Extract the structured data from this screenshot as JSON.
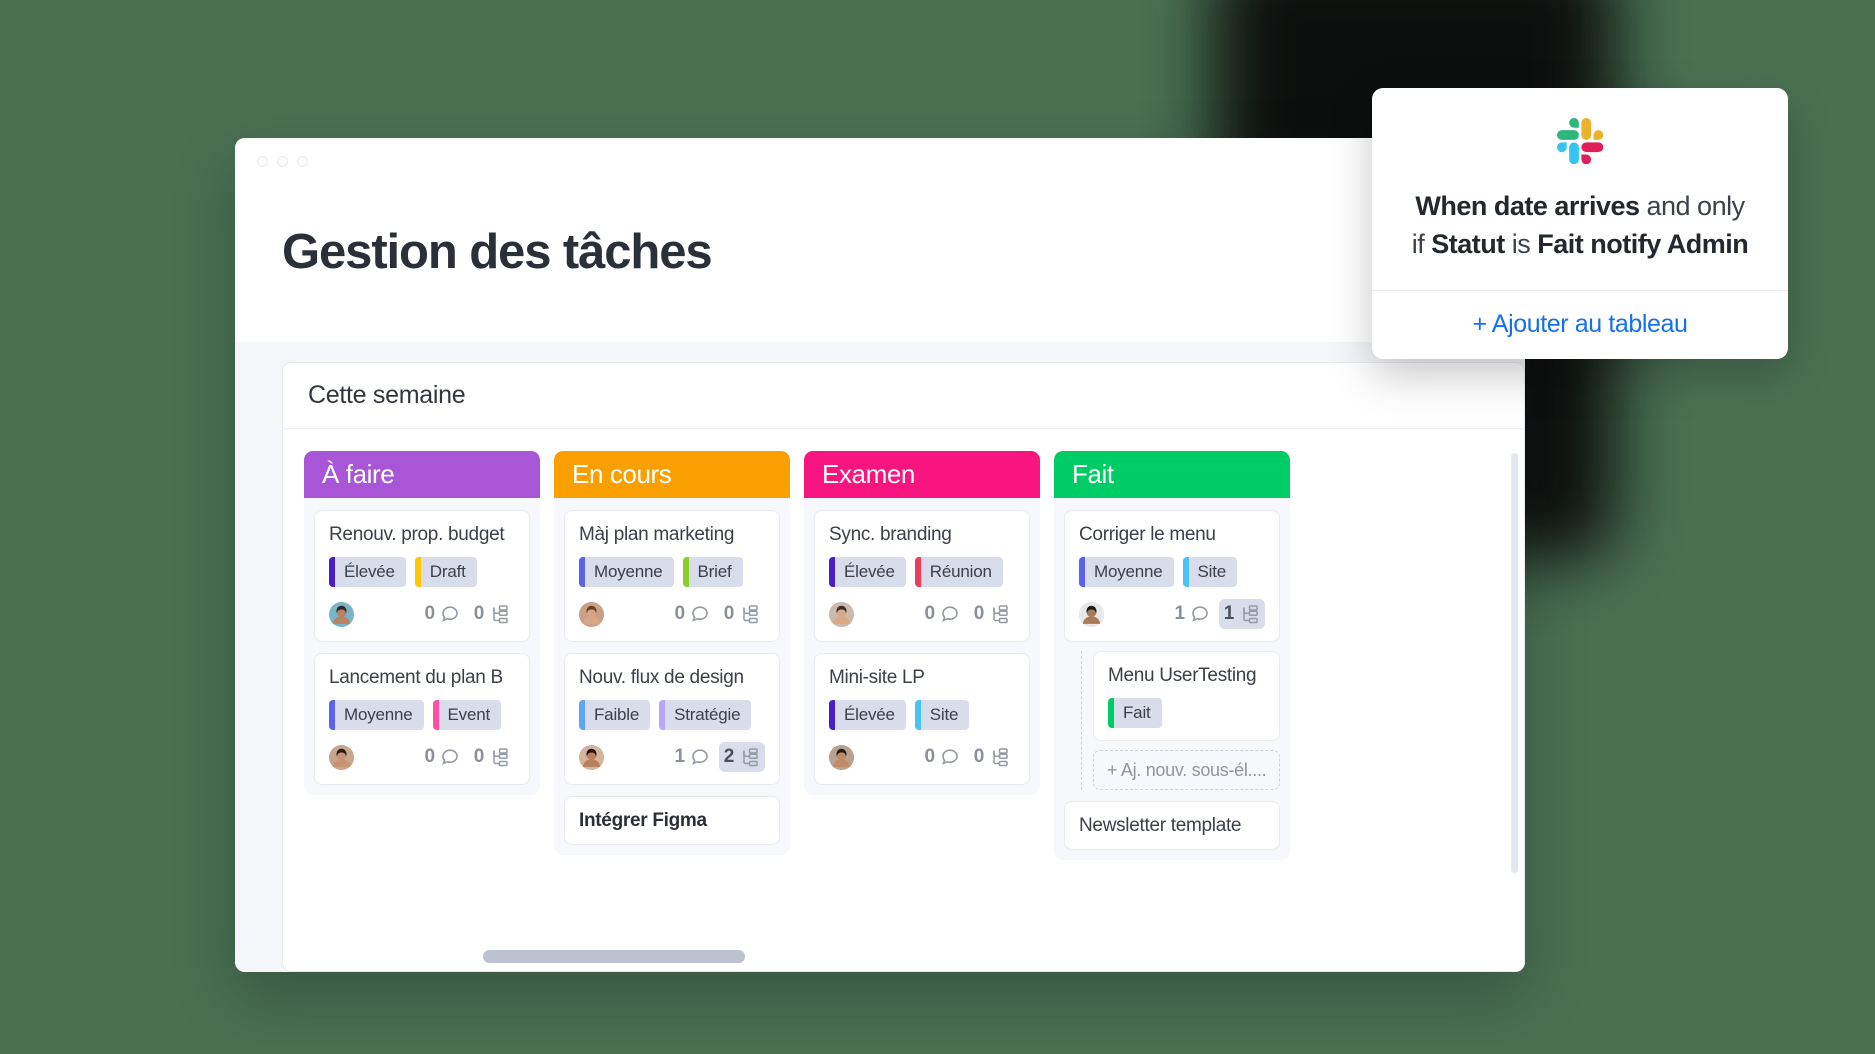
{
  "window": {
    "title": "Gestion des tâches",
    "traffic_lights": [
      "close",
      "minimize",
      "maximize"
    ]
  },
  "board": {
    "header": "Cette semaine",
    "columns": [
      {
        "name": "À faire",
        "color": "#a855d8",
        "tasks": [
          {
            "title": "Renouv. prop. budget",
            "bold": false,
            "tags": [
              {
                "label": "Élevée",
                "bar": "#4b1fc4"
              },
              {
                "label": "Draft",
                "bar": "#ffc700"
              }
            ],
            "avatar": "male-1",
            "comments": "0",
            "subtasks": "0",
            "subtasks_highlighted": false
          },
          {
            "title": "Lancement du plan B",
            "bold": false,
            "tags": [
              {
                "label": "Moyenne",
                "bar": "#5b63e8"
              },
              {
                "label": "Event",
                "bar": "#ff4fa3"
              }
            ],
            "avatar": "female-1",
            "comments": "0",
            "subtasks": "0",
            "subtasks_highlighted": false
          }
        ]
      },
      {
        "name": "En cours",
        "color": "#f9a000",
        "tasks": [
          {
            "title": "Màj plan marketing",
            "bold": false,
            "tags": [
              {
                "label": "Moyenne",
                "bar": "#5b63e8"
              },
              {
                "label": "Brief",
                "bar": "#8ace2a"
              }
            ],
            "avatar": "female-2",
            "comments": "0",
            "subtasks": "0",
            "subtasks_highlighted": false
          },
          {
            "title": "Nouv. flux de design",
            "bold": false,
            "tags": [
              {
                "label": "Faible",
                "bar": "#60a5fa"
              },
              {
                "label": "Stratégie",
                "bar": "#b9a6f7"
              }
            ],
            "avatar": "female-3",
            "comments": "1",
            "subtasks": "2",
            "subtasks_highlighted": true
          },
          {
            "title": "Intégrer Figma",
            "bold": true,
            "tags": [],
            "avatar": null,
            "comments": null,
            "subtasks": null,
            "subtasks_highlighted": false
          }
        ]
      },
      {
        "name": "Examen",
        "color": "#f8157f",
        "tasks": [
          {
            "title": "Sync. branding",
            "bold": false,
            "tags": [
              {
                "label": "Élevée",
                "bar": "#4b1fc4"
              },
              {
                "label": "Réunion",
                "bar": "#e8405a"
              }
            ],
            "avatar": "male-2",
            "comments": "0",
            "subtasks": "0",
            "subtasks_highlighted": false
          },
          {
            "title": "Mini-site LP",
            "bold": false,
            "tags": [
              {
                "label": "Élevée",
                "bar": "#4b1fc4"
              },
              {
                "label": "Site",
                "bar": "#4cc3f5"
              }
            ],
            "avatar": "female-4",
            "comments": "0",
            "subtasks": "0",
            "subtasks_highlighted": false
          }
        ]
      },
      {
        "name": "Fait",
        "color": "#00cc66",
        "tasks": [
          {
            "title": "Corriger le menu",
            "bold": false,
            "tags": [
              {
                "label": "Moyenne",
                "bar": "#5b63e8"
              },
              {
                "label": "Site",
                "bar": "#4cc3f5"
              }
            ],
            "avatar": "male-3",
            "comments": "1",
            "subtasks": "1",
            "subtasks_highlighted": true
          },
          {
            "title": "Menu UserTesting",
            "bold": false,
            "nested": true,
            "tags": [
              {
                "label": "Fait",
                "bar": "#00cc66"
              }
            ],
            "avatar": null,
            "comments": null,
            "subtasks": null,
            "subtasks_highlighted": false
          },
          {
            "title": "Newsletter template",
            "bold": false,
            "tags": [],
            "avatar": null,
            "comments": null,
            "subtasks": null,
            "subtasks_highlighted": false
          }
        ],
        "add_subtask_label": "+ Aj. nouv. sous-él...."
      }
    ]
  },
  "automation": {
    "logo": "slack-logo",
    "segments": [
      {
        "text": "When date arrives",
        "bold": true
      },
      {
        "text": " and only if ",
        "bold": false
      },
      {
        "text": "Statut",
        "bold": true
      },
      {
        "text": " is ",
        "bold": false
      },
      {
        "text": "Fait notify Admin",
        "bold": true
      }
    ],
    "add_label": "+ Ajouter au tableau",
    "link_color": "#1570ef"
  }
}
